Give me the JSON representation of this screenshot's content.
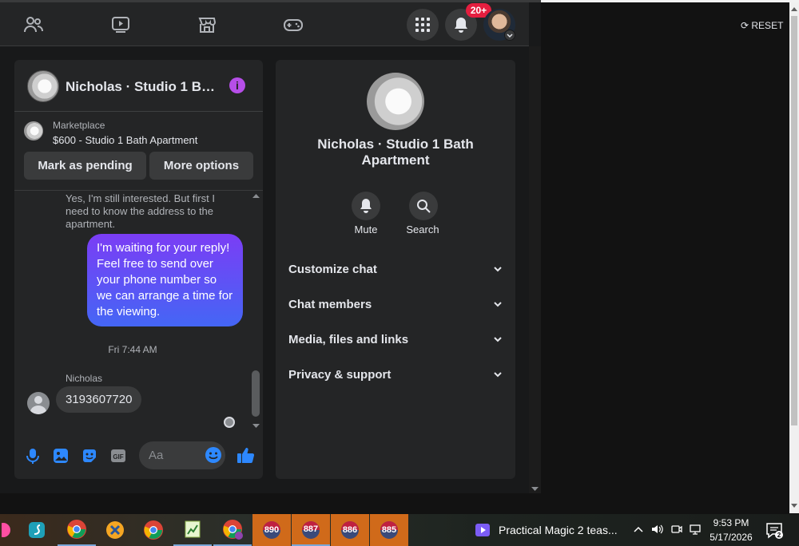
{
  "topnav": {
    "notification_count": "20+"
  },
  "chat": {
    "title": "Nicholas · Studio 1 Bat···",
    "listing": {
      "source": "Marketplace",
      "title": "$600 - Studio 1 Bath Apartment"
    },
    "buttons": {
      "mark_pending": "Mark as pending",
      "more_options": "More options"
    },
    "messages": {
      "quoted": "Yes, I'm still interested. But first I need to know the address to the apartment.",
      "mine": "I'm waiting for your reply! Feel free to send over your phone number so we can arrange a time for the viewing.",
      "timestamp": "Fri 7:44 AM",
      "sender": "Nicholas",
      "theirs": "3193607720"
    },
    "composer_placeholder": "Aa"
  },
  "details": {
    "name": "Nicholas · Studio 1 Bath Apartment",
    "actions": {
      "mute": "Mute",
      "search": "Search"
    },
    "sections": [
      "Customize chat",
      "Chat members",
      "Media, files and links",
      "Privacy & support"
    ]
  },
  "page": {
    "reset_label": "RESET"
  },
  "taskbar": {
    "badges": [
      "890",
      "887",
      "886",
      "885"
    ],
    "media_title": "Practical Magic 2 teas...",
    "time": "9:53 PM",
    "date": "5/17/2026"
  },
  "colors": {
    "accent": "#b64ee8",
    "bubble_gradient_start": "#7b3df5",
    "bubble_gradient_end": "#4466f5",
    "notification": "#e41e3f",
    "icon_blue": "#2d88ff"
  }
}
